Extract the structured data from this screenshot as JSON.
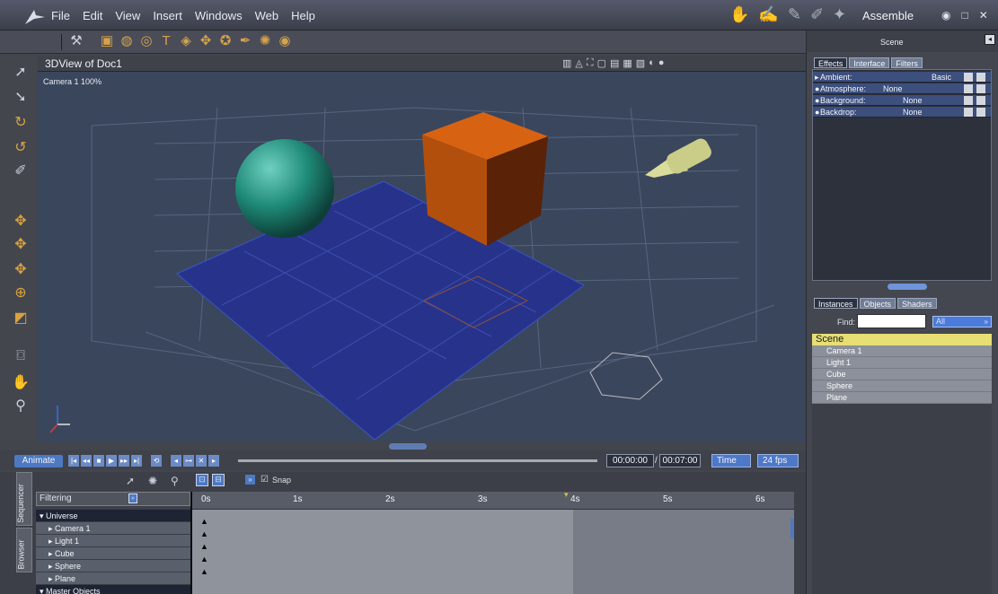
{
  "menubar": {
    "items": [
      "File",
      "Edit",
      "View",
      "Insert",
      "Windows",
      "Web",
      "Help"
    ],
    "room_name": "Assemble"
  },
  "viewport": {
    "title": "3DView of Doc1",
    "camera_label": "Camera 1 100%"
  },
  "animation": {
    "animate_label": "Animate",
    "current_time": "00:00:00",
    "separator": "/",
    "total_time": "00:07:00",
    "time_mode": "Time",
    "fps": "24 fps"
  },
  "sequencer": {
    "snap_label": "Snap",
    "filtering_label": "Filtering",
    "tabs": [
      "Sequencer",
      "Browser"
    ],
    "tree": {
      "universe": "Universe",
      "items": [
        "Camera 1",
        "Light 1",
        "Cube",
        "Sphere",
        "Plane"
      ],
      "master": "Master Objects"
    },
    "ruler": [
      "0s",
      "1s",
      "2s",
      "3s",
      "4s",
      "5s",
      "6s"
    ]
  },
  "right_panel": {
    "title": "Scene",
    "effect_tabs": [
      "Effects",
      "Interface",
      "Filters"
    ],
    "effects": [
      {
        "label": "Ambient:",
        "value": "Basic"
      },
      {
        "label": "Atmosphere:",
        "value": "None"
      },
      {
        "label": "Background:",
        "value": "None"
      },
      {
        "label": "Backdrop:",
        "value": "None"
      }
    ],
    "instance_tabs": [
      "Instances",
      "Objects",
      "Shaders"
    ],
    "find_label": "Find:",
    "find_value": "",
    "filter_value": "All",
    "scene_label": "Scene",
    "instances": [
      "Camera 1",
      "Light 1",
      "Cube",
      "Sphere",
      "Plane"
    ]
  },
  "colors": {
    "accent": "#4d78c2",
    "scene_highlight": "#e7de74",
    "viewport_bg": "#3a465c",
    "plane": "#27338a",
    "cube": "#b24f0d",
    "sphere": "#1f8a78",
    "light": "#d9dc9b"
  }
}
